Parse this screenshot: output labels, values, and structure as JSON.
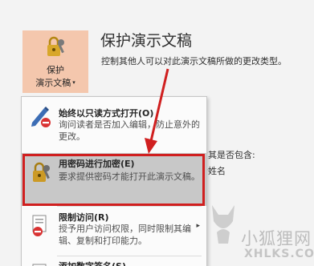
{
  "protect_button": {
    "line1": "保护",
    "line2": "演示文稿",
    "caret": "▾",
    "icon": "lock-key-icon"
  },
  "section": {
    "title": "保护演示文稿",
    "description": "控制其他人可以对此演示文稿所做的更改类型。"
  },
  "background_partial": {
    "line1": "意其是否包含:",
    "line2": "者姓名"
  },
  "menu": {
    "items": [
      {
        "title": "始终以只读方式打开(O)",
        "description": "询问读者是否加入编辑，防止意外的更改。",
        "icon": "pencil-no-icon"
      },
      {
        "title": "用密码进行加密(E)",
        "description": "要求提供密码才能打开此演示文稿。",
        "icon": "lock-key-icon"
      },
      {
        "title": "限制访问(R)",
        "description": "授予用户访问权限，同时限制其编辑、复制和打印能力。",
        "icon": "restrict-access-icon",
        "arrow": "▸"
      },
      {
        "title": "添加数字签名(S)",
        "icon": "signature-icon"
      }
    ]
  },
  "watermark": {
    "cn": "小狐狸网",
    "en": "XHLKS.COM"
  },
  "colors": {
    "accent_button": "#f4c7ad",
    "highlight_border": "#d01f1f",
    "selected_item": "#c8c8c8"
  }
}
